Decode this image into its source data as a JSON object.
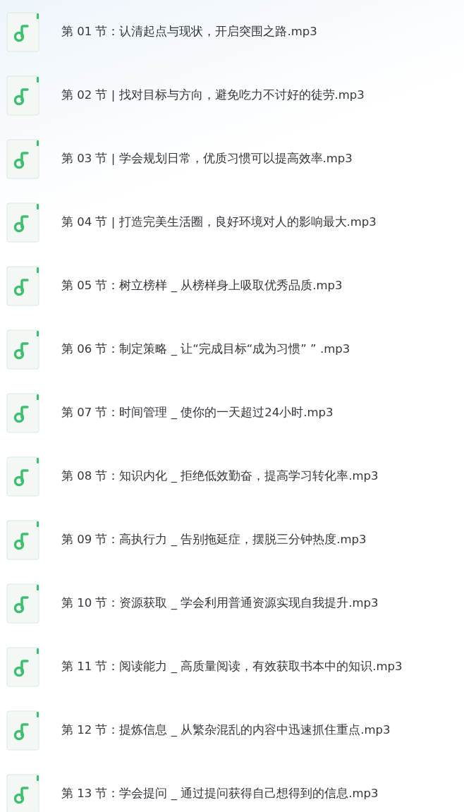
{
  "files": [
    {
      "name": "第 01 节：认清起点与现状，开启突围之路.mp3"
    },
    {
      "name": "第 02 节 | 找对目标与方向，避免吃力不讨好的徒劳.mp3"
    },
    {
      "name": "第 03 节 | 学会规划日常，优质习惯可以提高效率.mp3"
    },
    {
      "name": "第 04 节 | 打造完美生活圈，良好环境对人的影响最大.mp3"
    },
    {
      "name": "第 05 节：树立榜样 _ 从榜样身上吸取优秀品质.mp3"
    },
    {
      "name": "第 06 节：制定策略 _ 让“完成目标“成为习惯” ” .mp3"
    },
    {
      "name": "第 07 节：时间管理 _ 使你的一天超过24小时.mp3"
    },
    {
      "name": "第 08 节：知识内化 _ 拒绝低效勤奋，提高学习转化率.mp3"
    },
    {
      "name": "第 09 节：高执行力 _ 告别拖延症，摆脱三分钟热度.mp3"
    },
    {
      "name": "第 10 节：资源获取 _ 学会利用普通资源实现自我提升.mp3"
    },
    {
      "name": "第 11 节：阅读能力 _ 高质量阅读，有效获取书本中的知识.mp3"
    },
    {
      "name": "第 12 节：提炼信息 _ 从繁杂混乱的内容中迅速抓住重点.mp3"
    },
    {
      "name": "第 13 节：学会提问 _ 通过提问获得自己想得到的信息.mp3"
    }
  ]
}
